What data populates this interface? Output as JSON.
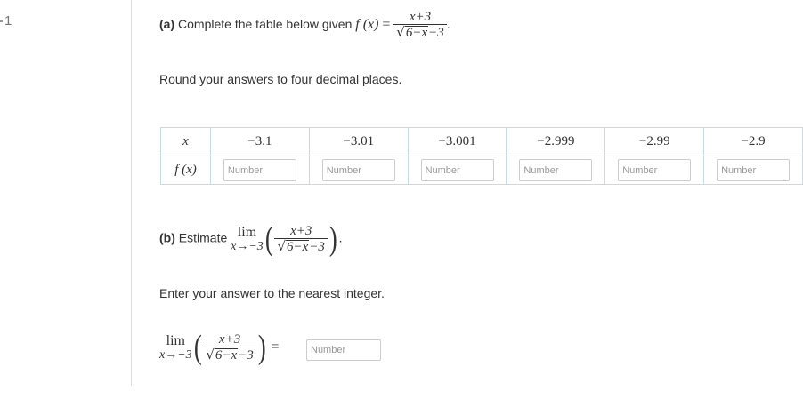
{
  "question": {
    "number": "1"
  },
  "part_a": {
    "label": "(a)",
    "prompt": "Complete the table below given",
    "func_name": "f (x)",
    "equals": "=",
    "numerator": "x+3",
    "den_radicand": "6−x",
    "den_tail": "−3",
    "period": ".",
    "round_note": "Round your answers to four decimal places."
  },
  "table": {
    "x_header": "x",
    "f_header": "f (x)",
    "x_values": [
      "−3.1",
      "−3.01",
      "−3.001",
      "−2.999",
      "−2.99",
      "−2.9"
    ],
    "input_placeholder": "Number"
  },
  "part_b": {
    "label": "(b)",
    "prompt": "Estimate",
    "lim_word": "lim",
    "lim_sub": "x→−3",
    "numerator": "x+3",
    "den_radicand": "6−x",
    "den_tail": "−3",
    "period": ".",
    "nearest_note": "Enter your answer to the nearest integer.",
    "answer_equals": "=",
    "answer_placeholder": "Number"
  },
  "colors": {
    "table_border": "#c5d9e8",
    "input_border": "#cccccc",
    "placeholder": "#999999",
    "divider": "#dddddd"
  }
}
